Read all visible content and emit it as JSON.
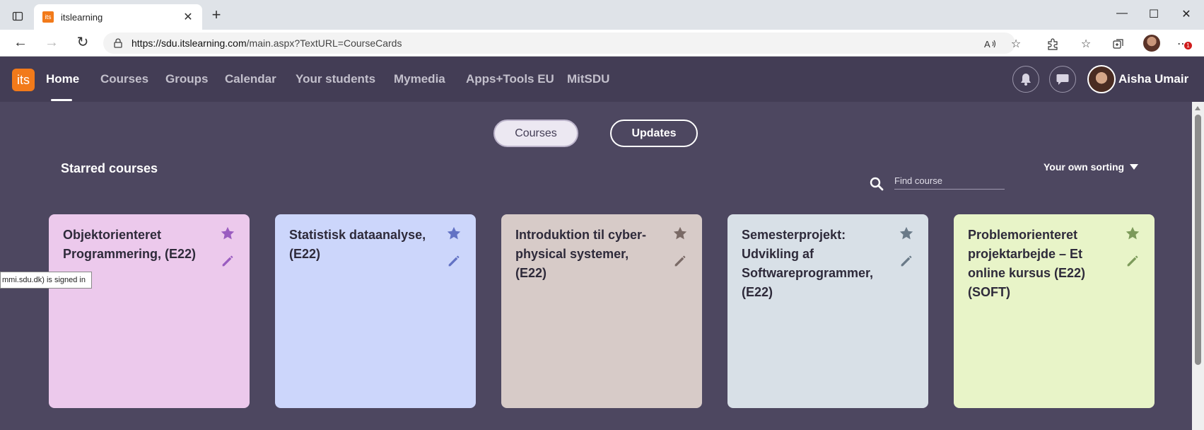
{
  "browser": {
    "tab_favicon": "its",
    "tab_title": "itslearning",
    "url_host": "https://sdu.itslearning.com",
    "url_path": "/main.aspx?TextURL=CourseCards",
    "notification_badge": "1"
  },
  "app": {
    "logo_text": "its",
    "nav": [
      {
        "label": "Home",
        "active": true
      },
      {
        "label": "Courses"
      },
      {
        "label": "Groups"
      },
      {
        "label": "Calendar"
      },
      {
        "label": "Your students"
      },
      {
        "label": "Mymedia"
      },
      {
        "label": "Apps+Tools EU"
      },
      {
        "label": "MitSDU"
      }
    ],
    "user_name": "Aisha Umair"
  },
  "view_toggle": {
    "courses_label": "Courses",
    "updates_label": "Updates"
  },
  "starred": {
    "title": "Starred courses",
    "search_placeholder": "Find course",
    "sort_label": "Your own sorting"
  },
  "cards": [
    {
      "title": "Objektorienteret Programmering, (E22)",
      "bg": "#ecc9ec",
      "icon_color": "#9a5cc0"
    },
    {
      "title": "Statistisk dataanalyse, (E22)",
      "bg": "#ccd6fb",
      "icon_color": "#6272c4"
    },
    {
      "title": "Introduktion til cyber-physical systemer, (E22)",
      "bg": "#d7cbc8",
      "icon_color": "#7a6a66"
    },
    {
      "title": "Semesterprojekt: Udvikling af Softwareprogrammer, (E22)",
      "bg": "#d8e0e7",
      "icon_color": "#6a7a88"
    },
    {
      "title": "Problemorienteret projektarbejde – Et online kursus (E22) (SOFT)",
      "bg": "#e8f4c8",
      "icon_color": "#7c9a5a"
    }
  ],
  "tooltip_text": "mmi.sdu.dk) is signed in"
}
